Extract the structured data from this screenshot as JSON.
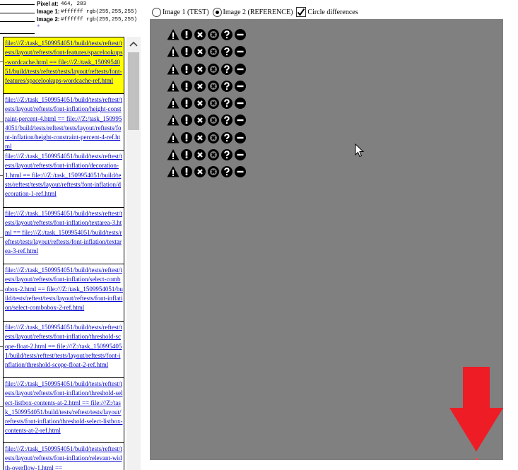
{
  "pixel_info": {
    "pixel_label": "Pixel at:",
    "pixel_value": "464, 283",
    "image1_label": "Image 1:",
    "image1_value": "#ffffff rgb(255,255,255)",
    "image2_label": "Image 2:",
    "image2_value": "#ffffff rgb(255,255,255)",
    "star": "*"
  },
  "controls": {
    "image1_label": "Image 1 (TEST)",
    "image2_label": "Image 2 (REFERENCE)",
    "circle_label": "Circle differences",
    "selected": "image2",
    "circle_checked": true
  },
  "tests": [
    {
      "text": "file:///Z:/task_1509954051/build/tests/reftest/tests/layout/reftests/font-features/spacelookups-wordcache.html == file:///Z:/task_1509954051/build/tests/reftest/tests/layout/reftests/font-features/spacelookups-wordcache-ref.html",
      "selected": true
    },
    {
      "text": "file:///Z:/task_1509954051/build/tests/reftest/tests/layout/reftests/font-inflation/height-constraint-percent-4.html == file:///Z:/task_1509954051/build/tests/reftest/tests/layout/reftests/font-inflation/height-constraint-percent-4-ref.html",
      "selected": false
    },
    {
      "text": "file:///Z:/task_1509954051/build/tests/reftest/tests/layout/reftests/font-inflation/decoration-1.html == file:///Z:/task_1509954051/build/tests/reftest/tests/layout/reftests/font-inflation/decoration-1-ref.html",
      "selected": false
    },
    {
      "text": "file:///Z:/task_1509954051/build/tests/reftest/tests/layout/reftests/font-inflation/textarea-3.html == file:///Z:/task_1509954051/build/tests/reftest/tests/layout/reftests/font-inflation/textarea-3-ref.html",
      "selected": false
    },
    {
      "text": "file:///Z:/task_1509954051/build/tests/reftest/tests/layout/reftests/font-inflation/select-combobox-2.html == file:///Z:/task_1509954051/build/tests/reftest/tests/layout/reftests/font-inflation/select-combobox-2-ref.html",
      "selected": false
    },
    {
      "text": "file:///Z:/task_1509954051/build/tests/reftest/tests/layout/reftests/font-inflation/threshold-scope-float-2.html == file:///Z:/task_1509954051/build/tests/reftest/tests/layout/reftests/font-inflation/threshold-scope-float-2-ref.html",
      "selected": false
    },
    {
      "text": "file:///Z:/task_1509954051/build/tests/reftest/tests/layout/reftests/font-inflation/threshold-select-listbox-contents-at-2.html == file:///Z:/task_1509954051/build/tests/reftest/tests/layout/reftests/font-inflation/threshold-select-listbox-contents-at-2-ref.html",
      "selected": false
    },
    {
      "text": "file:///Z:/task_1509954051/build/tests/reftest/tests/layout/reftests/font-inflation/relevant-width-overflow-1.html ==",
      "selected": false
    }
  ],
  "viewport": {
    "background": "#808080",
    "glyph_color": "#000000",
    "glyph_inner": "#ffffff",
    "icon_sequence": [
      "warning-triangle-icon",
      "exclamation-circle-icon",
      "x-circle-icon",
      "x-outline-circle-icon",
      "question-circle-icon",
      "minus-circle-icon"
    ],
    "icon_rows": 9,
    "arrow_color": "#ee1c25"
  },
  "colors": {
    "selected_bg": "#ffff00",
    "link": "#0000cc"
  }
}
